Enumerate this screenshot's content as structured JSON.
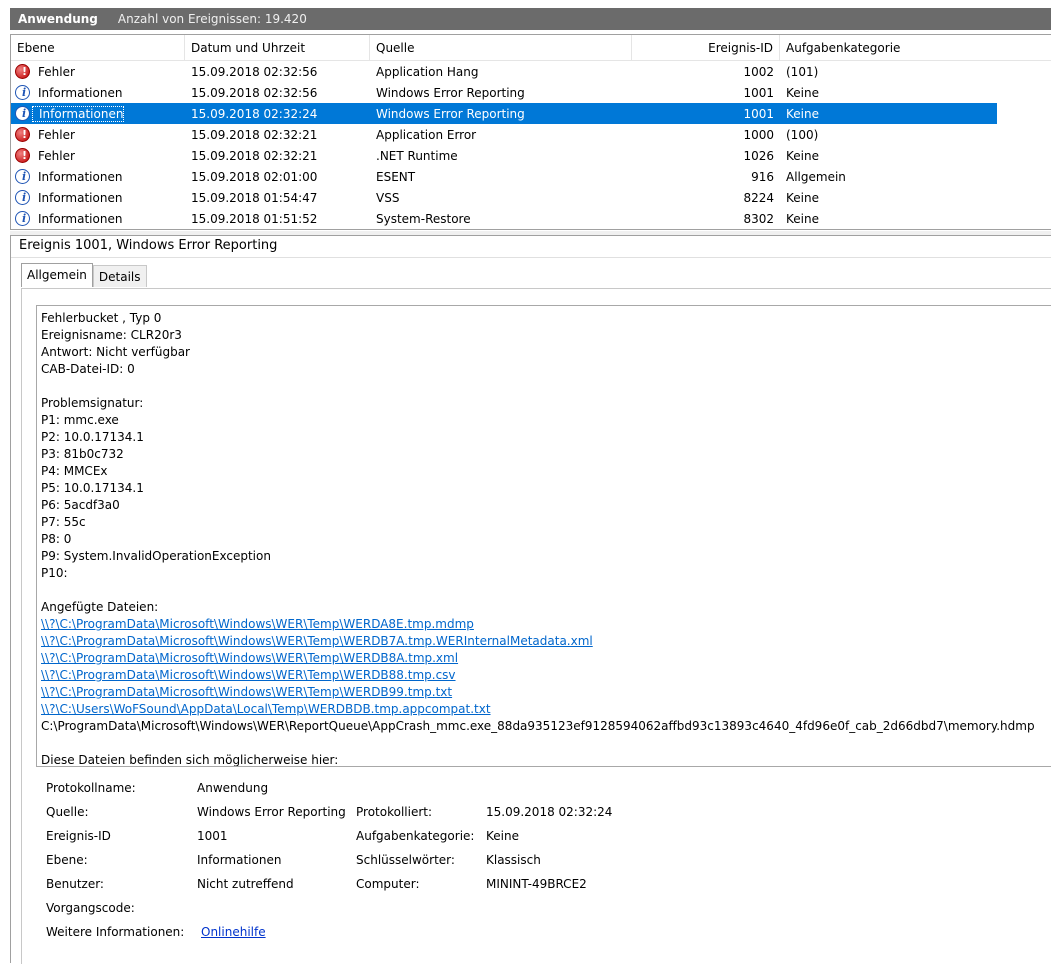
{
  "header": {
    "log_name": "Anwendung",
    "event_count": "Anzahl von Ereignissen: 19.420"
  },
  "columns": [
    "Ebene",
    "Datum und Uhrzeit",
    "Quelle",
    "Ereignis-ID",
    "Aufgabenkategorie"
  ],
  "events": [
    {
      "icon": "error-icon",
      "level": "Fehler",
      "datetime": "15.09.2018 02:32:56",
      "source": "Application Hang",
      "id": "1002",
      "category": "(101)"
    },
    {
      "icon": "info-icon",
      "level": "Informationen",
      "datetime": "15.09.2018 02:32:56",
      "source": "Windows Error Reporting",
      "id": "1001",
      "category": "Keine"
    },
    {
      "icon": "info-icon",
      "level": "Informationen",
      "datetime": "15.09.2018 02:32:24",
      "source": "Windows Error Reporting",
      "id": "1001",
      "category": "Keine",
      "selected": true
    },
    {
      "icon": "error-icon",
      "level": "Fehler",
      "datetime": "15.09.2018 02:32:21",
      "source": "Application Error",
      "id": "1000",
      "category": "(100)"
    },
    {
      "icon": "error-icon",
      "level": "Fehler",
      "datetime": "15.09.2018 02:32:21",
      "source": ".NET Runtime",
      "id": "1026",
      "category": "Keine"
    },
    {
      "icon": "info-icon",
      "level": "Informationen",
      "datetime": "15.09.2018 02:01:00",
      "source": "ESENT",
      "id": "916",
      "category": "Allgemein"
    },
    {
      "icon": "info-icon",
      "level": "Informationen",
      "datetime": "15.09.2018 01:54:47",
      "source": "VSS",
      "id": "8224",
      "category": "Keine"
    },
    {
      "icon": "info-icon",
      "level": "Informationen",
      "datetime": "15.09.2018 01:51:52",
      "source": "System-Restore",
      "id": "8302",
      "category": "Keine"
    }
  ],
  "detail": {
    "title": "Ereignis 1001, Windows Error Reporting",
    "tabs": [
      "Allgemein",
      "Details"
    ],
    "description_lines": [
      {
        "text": "Fehlerbucket , Typ 0"
      },
      {
        "text": "Ereignisname: CLR20r3"
      },
      {
        "text": "Antwort: Nicht verfügbar"
      },
      {
        "text": "CAB-Datei-ID: 0"
      },
      {
        "text": ""
      },
      {
        "text": "Problemsignatur:"
      },
      {
        "text": "P1: mmc.exe"
      },
      {
        "text": "P2: 10.0.17134.1"
      },
      {
        "text": "P3: 81b0c732"
      },
      {
        "text": "P4: MMCEx"
      },
      {
        "text": "P5: 10.0.17134.1"
      },
      {
        "text": "P6: 5acdf3a0"
      },
      {
        "text": "P7: 55c"
      },
      {
        "text": "P8: 0"
      },
      {
        "text": "P9: System.InvalidOperationException"
      },
      {
        "text": "P10:"
      },
      {
        "text": ""
      },
      {
        "text": "Angefügte Dateien:"
      },
      {
        "text": "\\\\?\\C:\\ProgramData\\Microsoft\\Windows\\WER\\Temp\\WERDA8E.tmp.mdmp",
        "link": true
      },
      {
        "text": "\\\\?\\C:\\ProgramData\\Microsoft\\Windows\\WER\\Temp\\WERDB7A.tmp.WERInternalMetadata.xml",
        "link": true
      },
      {
        "text": "\\\\?\\C:\\ProgramData\\Microsoft\\Windows\\WER\\Temp\\WERDB8A.tmp.xml",
        "link": true
      },
      {
        "text": "\\\\?\\C:\\ProgramData\\Microsoft\\Windows\\WER\\Temp\\WERDB88.tmp.csv",
        "link": true
      },
      {
        "text": "\\\\?\\C:\\ProgramData\\Microsoft\\Windows\\WER\\Temp\\WERDB99.tmp.txt",
        "link": true
      },
      {
        "text": "\\\\?\\C:\\Users\\WoFSound\\AppData\\Local\\Temp\\WERDBDB.tmp.appcompat.txt",
        "link": true
      },
      {
        "text": "C:\\ProgramData\\Microsoft\\Windows\\WER\\ReportQueue\\AppCrash_mmc.exe_88da935123ef9128594062affbd93c13893c4640_4fd96e0f_cab_2d66dbd7\\memory.hdmp"
      },
      {
        "text": ""
      },
      {
        "text": "Diese Dateien befinden sich möglicherweise hier:"
      }
    ],
    "properties": {
      "protokollname_label": "Protokollname:",
      "protokollname": "Anwendung",
      "quelle_label": "Quelle:",
      "quelle": "Windows Error Reporting",
      "protokolliert_label": "Protokolliert:",
      "protokolliert": "15.09.2018 02:32:24",
      "ereignis_id_label": "Ereignis-ID",
      "ereignis_id": "1001",
      "aufgabenkategorie_label": "Aufgabenkategorie:",
      "aufgabenkategorie": "Keine",
      "ebene_label": "Ebene:",
      "ebene": "Informationen",
      "schluesselwoerter_label": "Schlüsselwörter:",
      "schluesselwoerter": "Klassisch",
      "benutzer_label": "Benutzer:",
      "benutzer": "Nicht zutreffend",
      "computer_label": "Computer:",
      "computer": "MININT-49BRCE2",
      "vorgangscode_label": "Vorgangscode:",
      "weitere_label": "Weitere Informationen:",
      "onlinehilfe": "Onlinehilfe"
    }
  }
}
